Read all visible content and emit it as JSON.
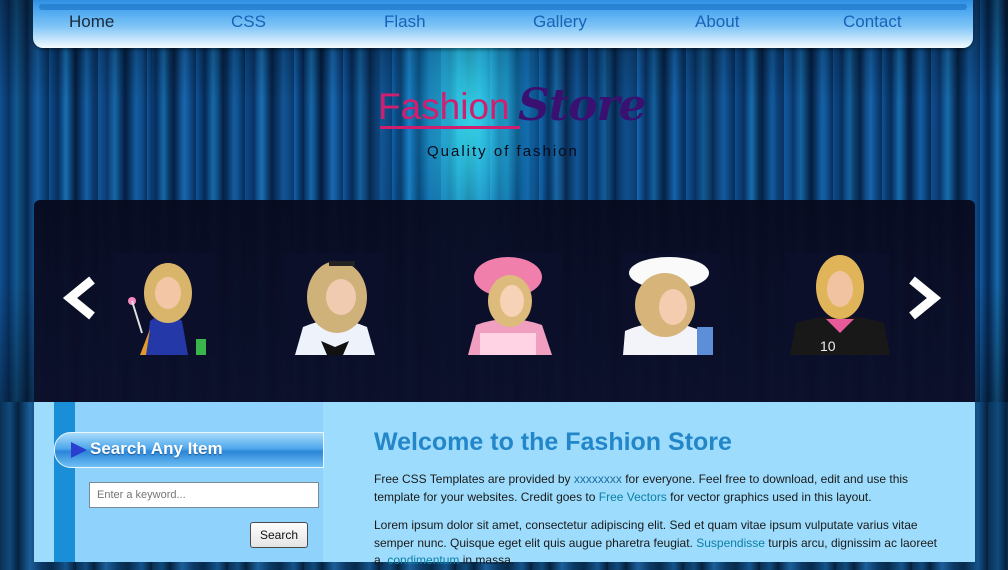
{
  "nav": {
    "items": [
      {
        "label": "Home",
        "active": true
      },
      {
        "label": "CSS"
      },
      {
        "label": "Flash"
      },
      {
        "label": "Gallery"
      },
      {
        "label": "About"
      },
      {
        "label": "Contact"
      }
    ]
  },
  "logo": {
    "word1": "Fashion",
    "word2": "Store",
    "tagline": "Quality of fashion"
  },
  "slider": {
    "prev_icon": "chevron-left-icon",
    "next_icon": "chevron-right-icon",
    "thumbnails": [
      "model-1",
      "model-2",
      "model-3",
      "model-4",
      "model-5"
    ]
  },
  "sidebar": {
    "search_title": "Search Any Item",
    "search_placeholder": "Enter a keyword...",
    "search_button": "Search"
  },
  "main": {
    "title": "Welcome to the Fashion Store",
    "p1_before": "Free CSS Templates are provided by ",
    "p1_link1": "xxxxxxxx",
    "p1_mid": " for everyone. Feel free to download, edit and use this template for your websites. Credit goes to ",
    "p1_link2": "Free Vectors",
    "p1_after": " for vector graphics used in this layout.",
    "p2_before": "Lorem ipsum dolor sit amet, consectetur adipiscing elit. Sed et quam vitae ipsum vulputate varius vitae semper nunc. Quisque eget elit quis augue pharetra feugiat. ",
    "p2_link1": "Suspendisse",
    "p2_mid": " turpis arcu, dignissim ac laoreet a, ",
    "p2_link2": "condimentum",
    "p2_after": " in massa."
  },
  "colors": {
    "accent": "#2386c8",
    "logo_pink": "#d21e6e",
    "logo_purple": "#3a1070",
    "link": "#0b7fa6"
  }
}
